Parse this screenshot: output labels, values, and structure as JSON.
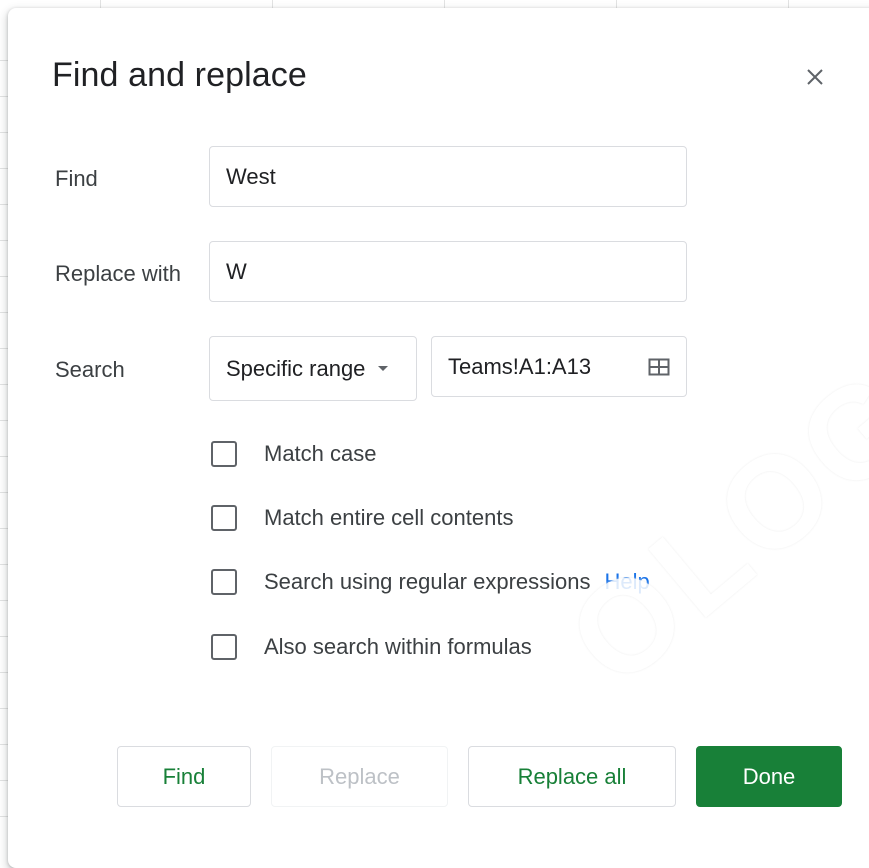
{
  "dialog": {
    "title": "Find and replace",
    "close_icon": "close-icon"
  },
  "find": {
    "label": "Find",
    "value": "West"
  },
  "replace": {
    "label": "Replace with",
    "value": "W"
  },
  "search": {
    "label": "Search",
    "scope_value": "Specific range",
    "range_value": "Teams!A1:A13",
    "range_icon": "grid-select-icon"
  },
  "options": [
    {
      "label": "Match case",
      "checked": false
    },
    {
      "label": "Match entire cell contents",
      "checked": false
    },
    {
      "label": "Search using regular expressions",
      "checked": false,
      "link": "Help"
    },
    {
      "label": "Also search within formulas",
      "checked": false
    }
  ],
  "buttons": {
    "find": "Find",
    "replace": "Replace",
    "replace_all": "Replace all",
    "done": "Done"
  },
  "colors": {
    "accent_green": "#188038",
    "link_blue": "#1a73e8",
    "disabled_text": "#bdc1c6"
  },
  "watermark": "OLOGY"
}
